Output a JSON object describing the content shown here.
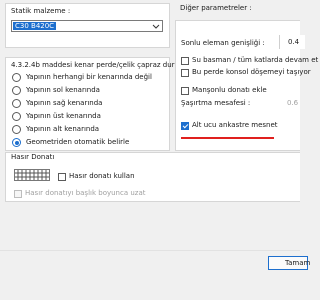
{
  "material": {
    "label": "Statik malzeme :",
    "selected": "C30 B420C"
  },
  "edge_section": {
    "heading": "4.3.2.4b maddesi kenar perde/çelik çapraz durumu :",
    "options": [
      {
        "label": "Yapının herhangi bir kenarında değil",
        "selected": false
      },
      {
        "label": "Yapının sol kenarında",
        "selected": false
      },
      {
        "label": "Yapının sağ kenarında",
        "selected": false
      },
      {
        "label": "Yapının üst kenarında",
        "selected": false
      },
      {
        "label": "Yapının alt kenarında",
        "selected": false
      },
      {
        "label": "Geometriden otomatik belirle",
        "selected": true
      }
    ]
  },
  "other_params": {
    "heading": "Diğer parametreler :",
    "end_width_label": "Sonlu eleman genişliği :",
    "end_width_value": "0.4",
    "basement_label": "Su basman / tüm katlarda devam et",
    "basement_checked": false,
    "cantilever_label": "Bu perde konsol döşemeyi taşıyor",
    "cantilever_checked": false,
    "mansonlu_label": "Manşonlu donatı ekle",
    "mansonlu_checked": false,
    "stagger_label": "Şaşırtma mesafesi :",
    "stagger_value": "0.6",
    "bottom_end_label": "Alt ucu ankastre mesnet",
    "bottom_end_checked": true
  },
  "rebar": {
    "heading": "Hasır Donatı",
    "use_label": "Hasır donatı kullan",
    "use_checked": false,
    "extend_label": "Hasır donatıyı başlık boyunca uzat",
    "extend_checked": false,
    "preview_icon": "mesh-icon"
  },
  "footer": {
    "ok_label": "Tamam"
  },
  "colors": {
    "accent": "#1d6fce",
    "annotation_red": "#e0201e"
  }
}
